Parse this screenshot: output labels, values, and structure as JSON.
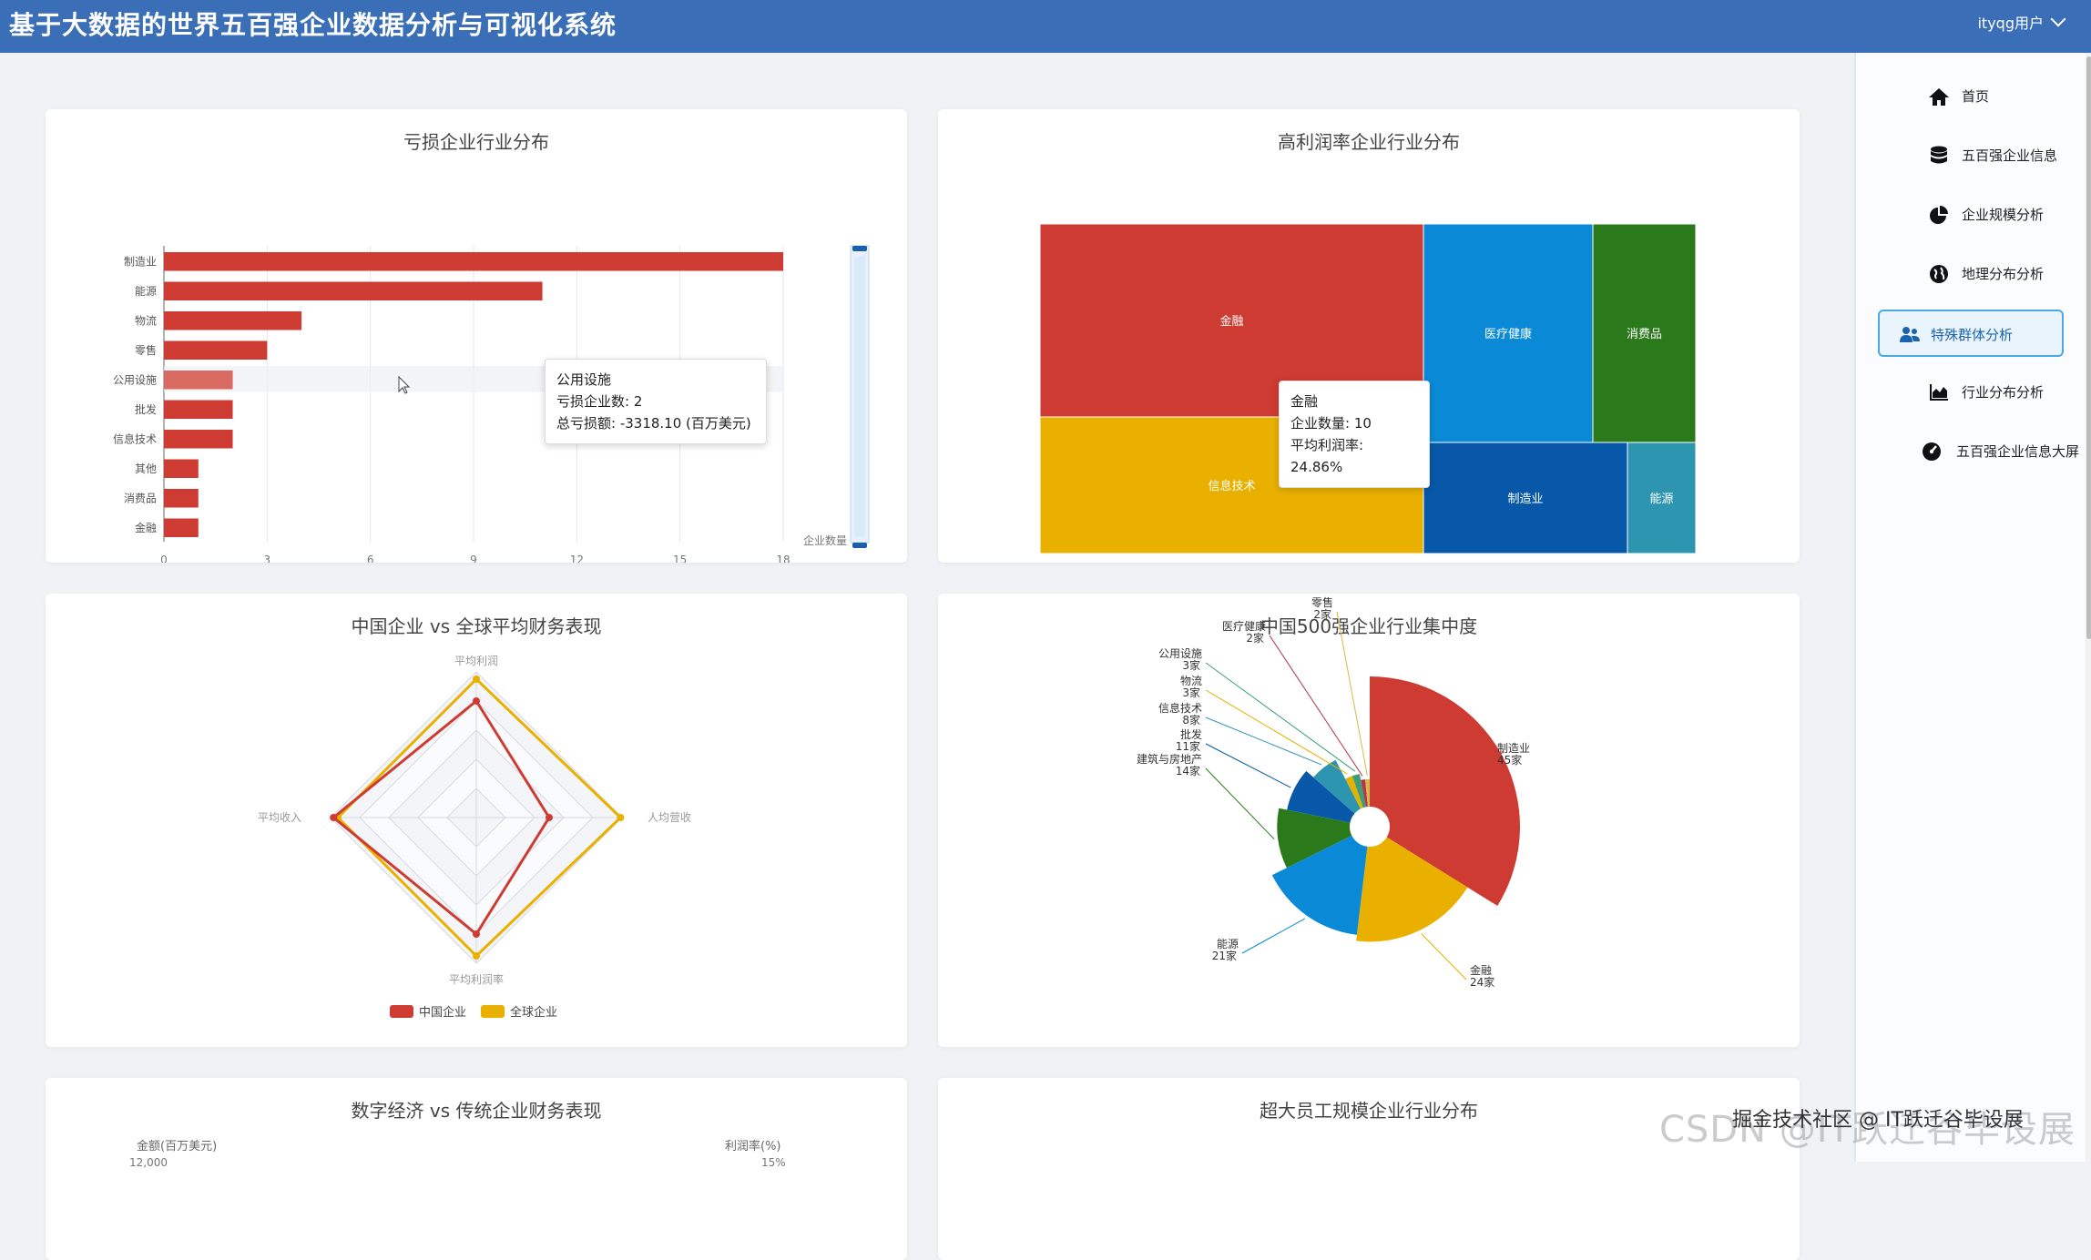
{
  "app": {
    "title": "基于大数据的世界五百强企业数据分析与可视化系统",
    "user": "ityqg用户"
  },
  "sidebar": {
    "items": [
      {
        "label": "首页",
        "icon": "home-icon",
        "active": false
      },
      {
        "label": "五百强企业信息",
        "icon": "database-icon",
        "active": false
      },
      {
        "label": "企业规模分析",
        "icon": "pie-chart-icon",
        "active": false
      },
      {
        "label": "地理分布分析",
        "icon": "globe-icon",
        "active": false
      },
      {
        "label": "特殊群体分析",
        "icon": "users-icon",
        "active": true
      },
      {
        "label": "行业分布分析",
        "icon": "area-chart-icon",
        "active": false
      },
      {
        "label": "五百强企业信息大屏",
        "icon": "dashboard-icon",
        "active": false
      }
    ]
  },
  "charts": {
    "loss": {
      "title": "亏损企业行业分布",
      "axis_name": "企业数量",
      "tooltip": {
        "name": "公用设施",
        "line1": "亏损企业数: 2",
        "line2": "总亏损额: -3318.10 (百万美元)"
      }
    },
    "treemap": {
      "title": "高利润率企业行业分布",
      "tooltip": {
        "name": "金融",
        "line1": "企业数量: 10",
        "line2": "平均利润率: 24.86%"
      }
    },
    "radar": {
      "title": "中国企业 vs 全球平均财务表现"
    },
    "rose": {
      "title": "中国500强企业行业集中度"
    },
    "digital": {
      "title": "数字经济 vs 传统企业财务表现",
      "left_axis": "金额(百万美元)",
      "right_axis": "利润率(%)",
      "left_tick": "12,000",
      "right_tick": "15%"
    },
    "staff": {
      "title": "超大员工规模企业行业分布"
    }
  },
  "chart_data": [
    {
      "type": "bar",
      "orientation": "horizontal",
      "title": "亏损企业行业分布",
      "categories": [
        "制造业",
        "能源",
        "物流",
        "零售",
        "公用设施",
        "批发",
        "信息技术",
        "其他",
        "消费品",
        "金融"
      ],
      "values": [
        18,
        11,
        4,
        3,
        2,
        2,
        2,
        1,
        1,
        1
      ],
      "xlim": [
        0,
        18
      ],
      "xticks": [
        "0",
        "3",
        "6",
        "9",
        "12",
        "15",
        "18"
      ],
      "xlabel": "企业数量",
      "color": "#cd3b32"
    },
    {
      "type": "treemap",
      "title": "高利润率企业行业分布",
      "labels": [
        "金融",
        "医疗健康",
        "消费品",
        "信息技术",
        "制造业",
        "能源"
      ],
      "colors": [
        "#cd3b32",
        "#0a8ad6",
        "#2a7a1c",
        "#e9b000",
        "#0758a8",
        "#2e95b0"
      ]
    },
    {
      "type": "radar",
      "title": "中国企业 vs 全球平均财务表现",
      "indicators": [
        "平均利润",
        "人均营收",
        "平均利润率",
        "平均收入"
      ],
      "series": [
        {
          "name": "中国企业",
          "values": [
            0.8,
            0.5,
            0.8,
            0.98
          ],
          "color": "#cd3b32"
        },
        {
          "name": "全球企业",
          "values": [
            0.95,
            0.99,
            0.95,
            0.95
          ],
          "color": "#e9b000"
        }
      ]
    },
    {
      "type": "pie",
      "variant": "rose",
      "title": "中国500强企业行业集中度",
      "labels": [
        "制造业",
        "金融",
        "能源",
        "建筑与房地产",
        "批发",
        "信息技术",
        "物流",
        "公用设施",
        "医疗健康",
        "零售"
      ],
      "values": [
        45,
        24,
        21,
        14,
        11,
        8,
        3,
        3,
        2,
        2
      ],
      "value_labels": [
        "45家",
        "24家",
        "21家",
        "14家",
        "11家",
        "8家",
        "3家",
        "3家",
        "2家",
        "2家"
      ],
      "colors": [
        "#cd3b32",
        "#e9b000",
        "#0a8ad6",
        "#2a7a1c",
        "#0758a8",
        "#2e95b0",
        "#e0b300",
        "#3d9c7a",
        "#b5364a",
        "#d8b84a"
      ]
    }
  ],
  "watermark": "掘金技术社区 @ IT跃迁谷毕设展",
  "watermark_bg": "CSDN @IT跃迁谷毕设展"
}
